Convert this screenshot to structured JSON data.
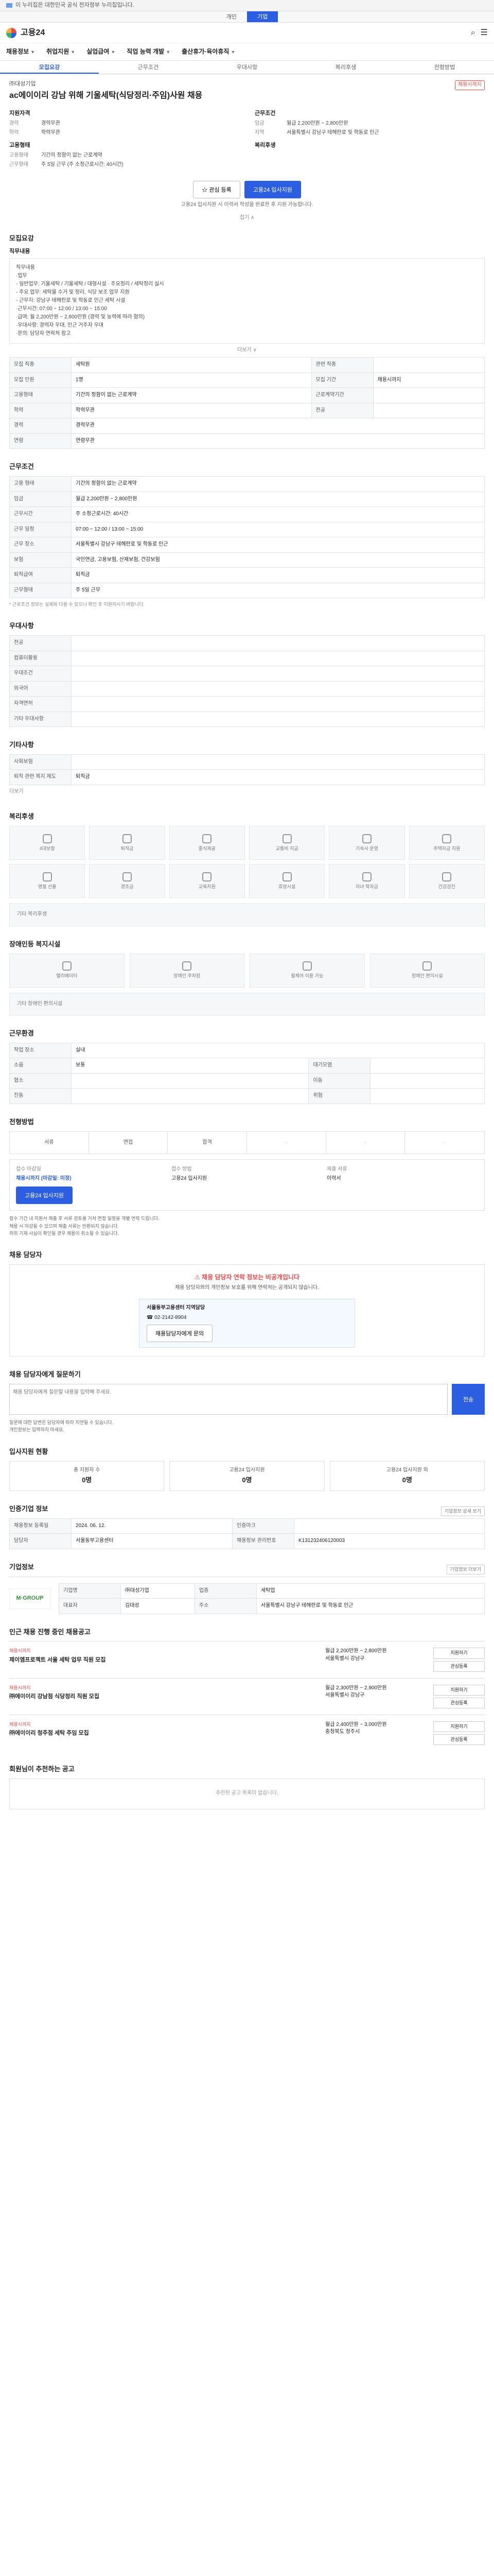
{
  "topbar": {
    "text": "이 누리집은 대한민국 공식 전자정부 누리집입니다."
  },
  "subtabs": [
    {
      "label": "개인",
      "active": false
    },
    {
      "label": "기업",
      "active": true
    }
  ],
  "brand": {
    "name": "고용24"
  },
  "gnb": [
    "채용정보",
    "취업지원",
    "실업급여",
    "직업 능력 개발",
    "출산휴가·육아휴직"
  ],
  "jobtabs": [
    "모집요강",
    "근무조건",
    "우대사항",
    "복리후생",
    "전형방법"
  ],
  "job": {
    "company": "㈜대성기업",
    "badge": "채용시까지",
    "title": "ac에이이리 강남 위해 기울세탁(식당정리·주임)사원 채용",
    "qual_title": "지원자격",
    "qual": [
      [
        "경력",
        "경력무관"
      ],
      [
        "학력",
        "학력무관"
      ]
    ],
    "work_title": "근무조건",
    "work": [
      [
        "임금",
        "월급 2,200만원 ~ 2,800만원"
      ],
      [
        "지역",
        "서울특별시 강남구 테헤란로 및 학동로 인근"
      ]
    ],
    "type_title": "고용형태",
    "type": [
      [
        "고용형태",
        "기간의 정함이 없는 근로계약"
      ],
      [
        "근무형태",
        "주 5일 근무 (주 소정근로시간: 40시간)"
      ]
    ],
    "mgr_title": "복리후생",
    "apply_btn": "관심 등록",
    "apply_primary": "고용24 입사지원",
    "notice": "고용24 입사지원 시 이력서 작성을 완료한 후 지원 가능합니다.",
    "fold": "접기 ∧"
  },
  "recruit": {
    "h": "모집요강",
    "sub": "직무내용",
    "duty": "직무내용\n·업무\n - 일반업무: 기울세탁 / 기울세탁 / 대형시설 · 주요정리 / 세탁정리 실시\n - 주요 업무: 세탁물 수거 및 정리, 식당 보조 업무 지원\n - 근무지: 강남구 테헤란로 및 학동로 인근 세탁 시설\n·근무시간: 07:00 ~ 12:00 / 13:00 ~ 15:00\n·급여: 월 2,200만원 ~ 2,800만원 (경력 및 능력에 따라 협의)\n·우대사항: 경력자 우대, 인근 거주자 우대\n·문의: 담당자 연락처 참고",
    "more": "더보기 ∨",
    "rows": [
      [
        "모집 직종",
        "세탁원",
        "관련 직종",
        ""
      ],
      [
        "모집 인원",
        "1명",
        "모집 기간",
        "채용시까지"
      ],
      [
        "고용형태",
        "기간의 정함이 없는 근로계약",
        "근로계약기간",
        ""
      ],
      [
        "학력",
        "학력무관",
        "전공",
        ""
      ],
      [
        "경력",
        "경력무관",
        "",
        ""
      ],
      [
        "연령",
        "연령무관",
        "",
        ""
      ]
    ]
  },
  "conditions": {
    "h": "근무조건",
    "rows": [
      [
        "고용 형태",
        "기간의 정함이 없는 근로계약"
      ],
      [
        "임금",
        "월급 2,200만원 ~ 2,800만원"
      ],
      [
        "근무시간",
        "주 소정근로시간: 40시간"
      ],
      [
        "근무 일정",
        "07:00 ~ 12:00 / 13:00 ~ 15:00"
      ],
      [
        "근무 장소",
        "서울특별시 강남구 테헤란로 및 학동로 인근"
      ],
      [
        "보험",
        "국민연금, 고용보험, 산재보험, 건강보험"
      ],
      [
        "퇴직급여",
        "퇴직금"
      ],
      [
        "근무형태",
        "주 5일 근무"
      ]
    ],
    "note": "* 근로조건 정보는 실제와 다를 수 있으니 확인 후 지원하시기 바랍니다."
  },
  "prefer": {
    "h": "우대사항",
    "rows": [
      [
        "전공",
        ""
      ],
      [
        "컴퓨터활용",
        ""
      ],
      [
        "우대조건",
        ""
      ],
      [
        "외국어",
        ""
      ],
      [
        "자격면허",
        ""
      ],
      [
        "기타 우대사항",
        ""
      ]
    ]
  },
  "extra": {
    "h": "기타사항",
    "rows": [
      [
        "사회보험",
        ""
      ],
      [
        "퇴직 관련 복지 제도",
        "퇴직금"
      ]
    ],
    "more": "더보기"
  },
  "welfare": {
    "h": "복리후생",
    "items": [
      "4대보험",
      "퇴직금",
      "중식제공",
      "교통비 지급",
      "기숙사 운영",
      "주택자금 지원",
      "명절 선물",
      "경조금",
      "교육지원",
      "휴양시설",
      "자녀 학자금",
      "건강검진"
    ],
    "etc_label": "기타 복리후생"
  },
  "disabled": {
    "h": "장애인등 복지시설",
    "items": [
      "엘리베이터",
      "장애인 주차장",
      "휠체어 이용 가능",
      "장애인 편의시설"
    ],
    "etc_label": "기타 장애인 편의시설"
  },
  "worktime": {
    "h": "근무환경",
    "rows": [
      [
        "작업 장소",
        "실내"
      ],
      [
        "소음",
        "보통",
        "대기오염",
        ""
      ],
      [
        "협소",
        "",
        "이동",
        ""
      ],
      [
        "진동",
        "",
        "위험",
        ""
      ]
    ]
  },
  "selection": {
    "h": "전형방법",
    "steps": [
      "서류",
      "면접",
      "합격",
      "-",
      "-",
      "-"
    ],
    "apply": [
      [
        "접수 마감일",
        "채용시까지 (마감일: 미정)"
      ],
      [
        "접수 방법",
        "고용24 입사지원"
      ],
      [
        "제출 서류",
        "이력서"
      ]
    ],
    "apply_btn": "고용24 입사지원",
    "bullets": [
      "접수 기간 내 지원서 제출 후 서류 검토를 거쳐 면접 일정을 개별 연락 드립니다.",
      "채용 시 마감될 수 있으며 제출 서류는 반환되지 않습니다.",
      "허위 기재 사실이 확인될 경우 채용이 취소될 수 있습니다."
    ]
  },
  "manager": {
    "h": "채용 담당자",
    "warn": "채용 담당자 연락 정보는 비공개입니다",
    "desc": "채용 담당자와의 개인정보 보호를 위해 연락처는 공개되지 않습니다.",
    "card_title": "서울동부고용센터 지역담당",
    "card_tel": "02-2142-8904",
    "card_btn": "채용담당자에게 문의"
  },
  "qna": {
    "h": "채용 담당자에게 질문하기",
    "placeholder": "채용 담당자에게 질문할 내용을 입력해 주세요.",
    "send": "전송",
    "bullets": [
      "질문에 대한 답변은 담당자에 따라 지연될 수 있습니다.",
      "개인정보는 입력하지 마세요."
    ]
  },
  "stats": {
    "h": "입사지원 현황",
    "items": [
      [
        "총 지원자 수",
        "0명"
      ],
      [
        "고용24 입사지원",
        "0명"
      ],
      [
        "고용24 입사지원 외",
        "0명"
      ]
    ]
  },
  "org": {
    "h": "인증기업 정보",
    "rows": [
      [
        "채용정보 등록일",
        "2024. 06. 12."
      ],
      [
        "인증마크",
        ""
      ],
      [
        "담당자",
        "서울동부고용센터"
      ],
      [
        "채용정보 관리번호",
        "K131232406120003"
      ]
    ],
    "action": "기업정보 상세 보기"
  },
  "company": {
    "h": "기업정보",
    "logo": "M·GROUP",
    "rows": [
      [
        "기업명",
        "㈜대성기업"
      ],
      [
        "업종",
        "세탁업"
      ],
      [
        "대표자",
        "김대성"
      ],
      [
        "주소",
        "서울특별시 강남구 테헤란로 및 학동로 인근"
      ]
    ],
    "more": "기업정보 더보기"
  },
  "related": {
    "h": "인근 채용 진행 중인 채용공고",
    "items": [
      {
        "tag": "채용시까지",
        "title": "제이엠프로젝트 서울 세탁 업무 직원 모집",
        "pay": "월급 2,200만원 ~ 2,800만원",
        "region": "서울특별시 강남구"
      },
      {
        "tag": "채용시까지",
        "title": "㈜에이이리 강남점 식당정리 직원 모집",
        "pay": "월급 2,300만원 ~ 2,900만원",
        "region": "서울특별시 강남구"
      },
      {
        "tag": "채용시까지",
        "title": "㈜에이이리 청주점 세탁 주임 모집",
        "pay": "월급 2,400만원 ~ 3,000만원",
        "region": "충청북도 청주시"
      }
    ],
    "btns": [
      "지원하기",
      "관심등록"
    ]
  },
  "recommend": {
    "h": "회원님이 추천하는 공고",
    "empty": "추천된 공고 목록이 없습니다."
  },
  "colors": {
    "accent": "#2b5ee0",
    "warn": "#e94b4b"
  }
}
